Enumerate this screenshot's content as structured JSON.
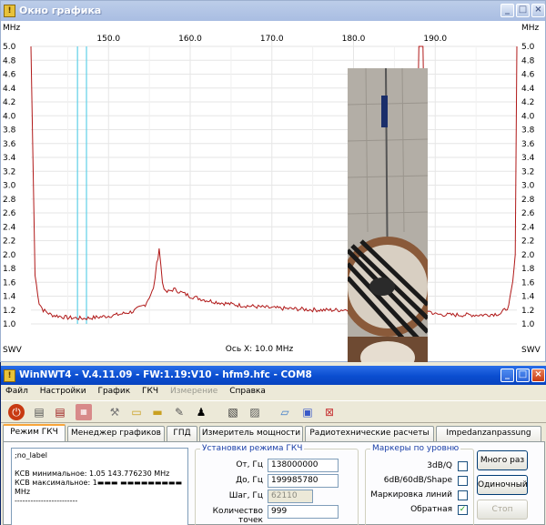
{
  "graph_window": {
    "title": "Окно графика",
    "controls": [
      "_",
      "□",
      "×"
    ]
  },
  "chart_data": {
    "type": "line",
    "x_unit": "MHz",
    "y_unit": "SWV",
    "x_ticks": [
      150.0,
      160.0,
      170.0,
      180.0,
      190.0
    ],
    "x_range": [
      140.5,
      200.0
    ],
    "ylim": [
      1.0,
      5.0
    ],
    "y_ticks": [
      "5.0",
      "4.8",
      "4.6",
      "4.4",
      "4.2",
      "4.0",
      "3.8",
      "3.6",
      "3.4",
      "3.2",
      "3.0",
      "2.8",
      "2.6",
      "2.4",
      "2.2",
      "2.0",
      "1.8",
      "1.6",
      "1.4",
      "1.2",
      "1.0"
    ],
    "x_axis_label": "Ось X: 10.0 MHz",
    "grid": true,
    "series": [
      {
        "color": "#b01818",
        "x": [
          140.5,
          141.0,
          141.5,
          142.0,
          143.0,
          145.0,
          147.0,
          149.0,
          151.0,
          153.0,
          154.5,
          155.5,
          155.9,
          156.2,
          156.6,
          157.0,
          158.0,
          159.0,
          160.0,
          162.0,
          164.0,
          166.0,
          168.0,
          170.0,
          172.0,
          174.0,
          176.0,
          178.0,
          180.0,
          182.0,
          184.0,
          186.0,
          187.5,
          188.0,
          188.5,
          189.0,
          190.0,
          192.0,
          194.0,
          196.0,
          198.0,
          199.0,
          199.5,
          199.8,
          200.0
        ],
        "y": [
          5.0,
          1.7,
          1.3,
          1.2,
          1.13,
          1.09,
          1.08,
          1.1,
          1.13,
          1.18,
          1.28,
          1.5,
          1.85,
          2.1,
          1.6,
          1.45,
          1.5,
          1.45,
          1.4,
          1.34,
          1.3,
          1.27,
          1.25,
          1.23,
          1.22,
          1.21,
          1.2,
          1.2,
          1.21,
          1.22,
          1.23,
          1.3,
          1.55,
          5.0,
          5.0,
          1.2,
          1.14,
          1.13,
          1.13,
          1.13,
          1.15,
          1.25,
          1.6,
          2.0,
          5.0
        ]
      }
    ],
    "cursors_x": [
      146.2,
      147.3
    ]
  },
  "nwt_window": {
    "title": "WinNWT4 - V.4.11.09 - FW:1.19:V10 - hfm9.hfc - COM8",
    "menu": [
      {
        "label": "Файл",
        "disabled": false
      },
      {
        "label": "Настройки",
        "disabled": false
      },
      {
        "label": "График",
        "disabled": false
      },
      {
        "label": "ГКЧ",
        "disabled": false
      },
      {
        "label": "Измерение",
        "disabled": true
      },
      {
        "label": "Справка",
        "disabled": false
      }
    ],
    "tabs": [
      "Режим ГКЧ",
      "Менеджер графиков",
      "ГПД",
      "Измеритель мощности",
      "Радиотехнические расчеты",
      "Impedanzanpassung"
    ],
    "log_lines": [
      ";no_label",
      "",
      "КСВ минимальное: 1.05  143.776230 MHz",
      "КСВ максимальное: 1▬▬▬ ▬▬▬▬▬▬▬▬▬ MHz",
      "------------------------"
    ],
    "sweep": {
      "legend": "Установки режима ГКЧ",
      "from_label": "От, Гц",
      "from_value": "138000000",
      "to_label": "До, Гц",
      "to_value": "199985780",
      "step_label": "Шаг, Гц",
      "step_value": "62110",
      "points_label": "Количество точек",
      "points_value": "999"
    },
    "markers": {
      "legend": "Маркеры по уровню",
      "items": [
        {
          "label": "3dB/Q",
          "checked": false
        },
        {
          "label": "6dB/60dB/Shape",
          "checked": false
        },
        {
          "label": "Маркировка линий",
          "checked": false
        },
        {
          "label": "Обратная",
          "checked": true
        }
      ]
    },
    "buttons": {
      "multi": "Много раз",
      "single": "Одиночный",
      "stop": "Стоп"
    }
  }
}
